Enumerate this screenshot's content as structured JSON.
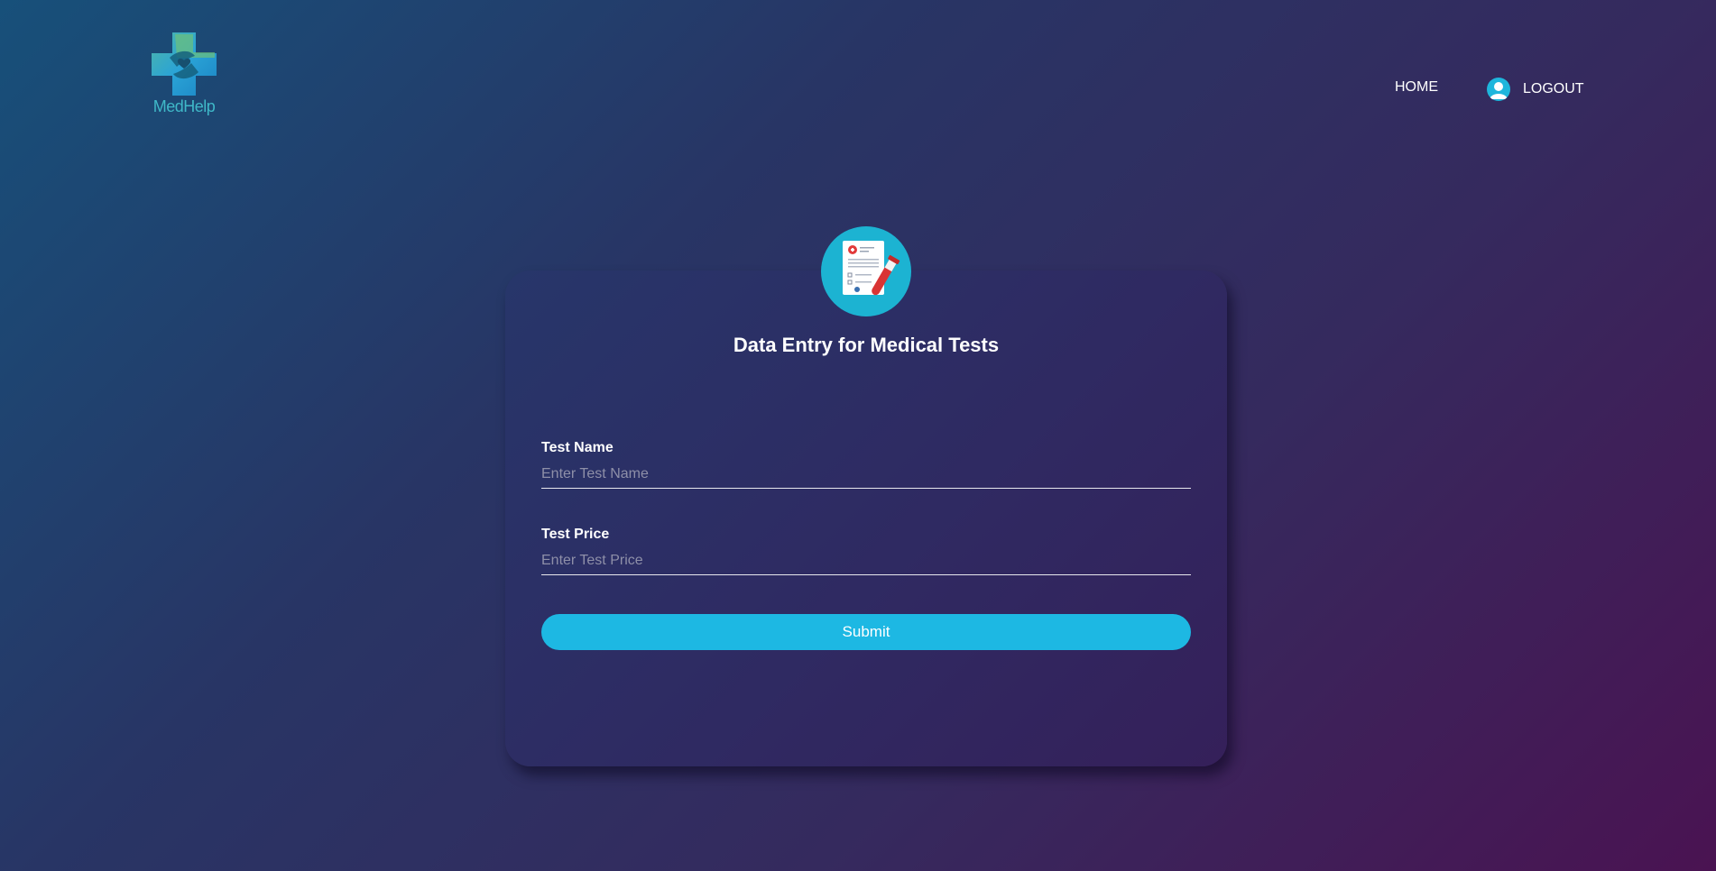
{
  "brand": {
    "logo_text": "MedHelp"
  },
  "nav": {
    "home_label": "HOME",
    "logout_label": "LOGOUT"
  },
  "form": {
    "title": "Data Entry for Medical Tests",
    "fields": [
      {
        "label": "Test Name",
        "placeholder": "Enter Test Name",
        "value": ""
      },
      {
        "label": "Test Price",
        "placeholder": "Enter Test Price",
        "value": ""
      }
    ],
    "submit_label": "Submit"
  },
  "colors": {
    "accent": "#1db8e3",
    "logo_teal": "#3fb8c8",
    "logo_green": "#6cc07a"
  },
  "icons": {
    "logo": "medical-cross-hands-icon",
    "user": "user-avatar-icon",
    "card": "medical-report-test-tube-icon"
  }
}
